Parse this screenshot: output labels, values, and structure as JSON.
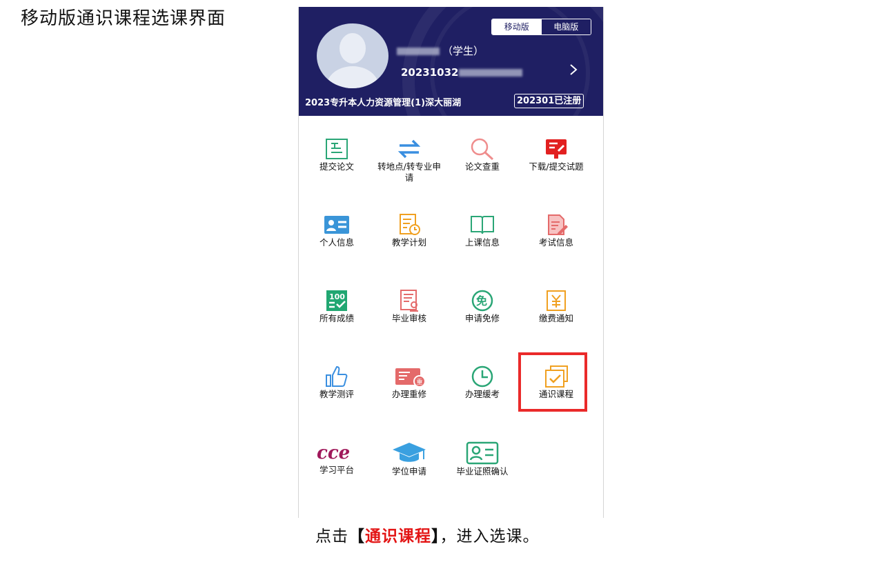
{
  "page_title": "移动版通识课程选课界面",
  "header": {
    "mode_mobile": "移动版",
    "mode_desktop": "电脑版",
    "role_suffix": "（学生）",
    "student_id_prefix": "20231032",
    "class_name": "2023专升本人力资源管理(1)深大丽湖",
    "registration": "202301已注册",
    "colors": {
      "header_bg": "#1f1f63",
      "highlight": "#ea2a2a"
    }
  },
  "menu": [
    {
      "label": "提交论文",
      "icon": "paper-submit-icon"
    },
    {
      "label": "转地点/转专业申请",
      "icon": "swap-arrows-icon"
    },
    {
      "label": "论文查重",
      "icon": "magnifier-icon"
    },
    {
      "label": "下载/提交试题",
      "icon": "exam-download-icon"
    },
    {
      "label": "个人信息",
      "icon": "id-card-icon"
    },
    {
      "label": "教学计划",
      "icon": "plan-clock-icon"
    },
    {
      "label": "上课信息",
      "icon": "open-book-icon"
    },
    {
      "label": "考试信息",
      "icon": "exam-edit-icon"
    },
    {
      "label": "所有成绩",
      "icon": "score-100-icon"
    },
    {
      "label": "毕业审核",
      "icon": "graduation-audit-icon"
    },
    {
      "label": "申请免修",
      "icon": "exempt-icon"
    },
    {
      "label": "缴费通知",
      "icon": "yuan-payment-icon"
    },
    {
      "label": "教学测评",
      "icon": "thumbs-up-icon"
    },
    {
      "label": "办理重修",
      "icon": "retake-icon"
    },
    {
      "label": "办理缓考",
      "icon": "clock-icon"
    },
    {
      "label": "通识课程",
      "icon": "check-layers-icon"
    },
    {
      "label": "学习平台",
      "icon": "cce-logo-icon"
    },
    {
      "label": "学位申请",
      "icon": "graduation-cap-icon"
    },
    {
      "label": "毕业证照确认",
      "icon": "id-photo-icon"
    }
  ],
  "caption": {
    "prefix": "点击",
    "bracket_open": "【",
    "highlight": "通识课程",
    "bracket_close": "】",
    "suffix": "，进入选课。"
  }
}
